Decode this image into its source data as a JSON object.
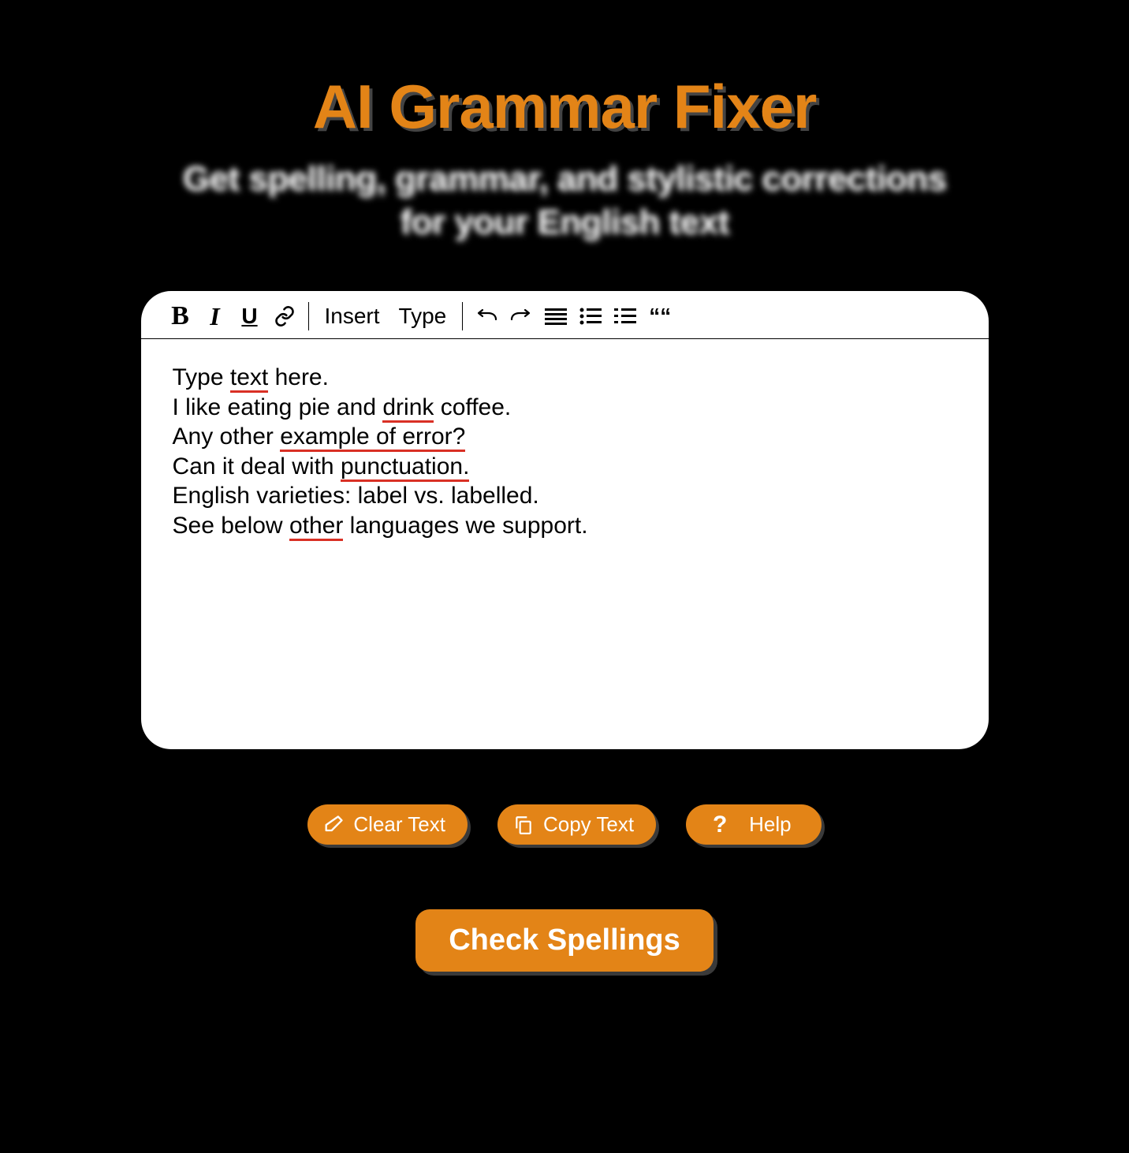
{
  "header": {
    "title": "AI Grammar Fixer",
    "subtitle_line1": "Get spelling, grammar, and stylistic corrections",
    "subtitle_line2": "for your English text"
  },
  "toolbar": {
    "bold": "B",
    "italic": "I",
    "underline": "U",
    "insert": "Insert",
    "type": "Type",
    "quote": "““"
  },
  "content": {
    "l1a": "Type ",
    "l1b": "text",
    "l1c": " here.",
    "l2a": "I like eating pie and ",
    "l2b": "drink",
    "l2c": " coffee.",
    "l3a": "Any other ",
    "l3b": "example of error?",
    "l4a": "Can it deal with ",
    "l4b": "punctuation.",
    "l5": "English varieties: label vs. labelled.",
    "l6a": "See below ",
    "l6b": "other",
    "l6c": " languages we support."
  },
  "buttons": {
    "clear": "Clear Text",
    "copy": "Copy Text",
    "help": "Help",
    "check": "Check Spellings"
  }
}
